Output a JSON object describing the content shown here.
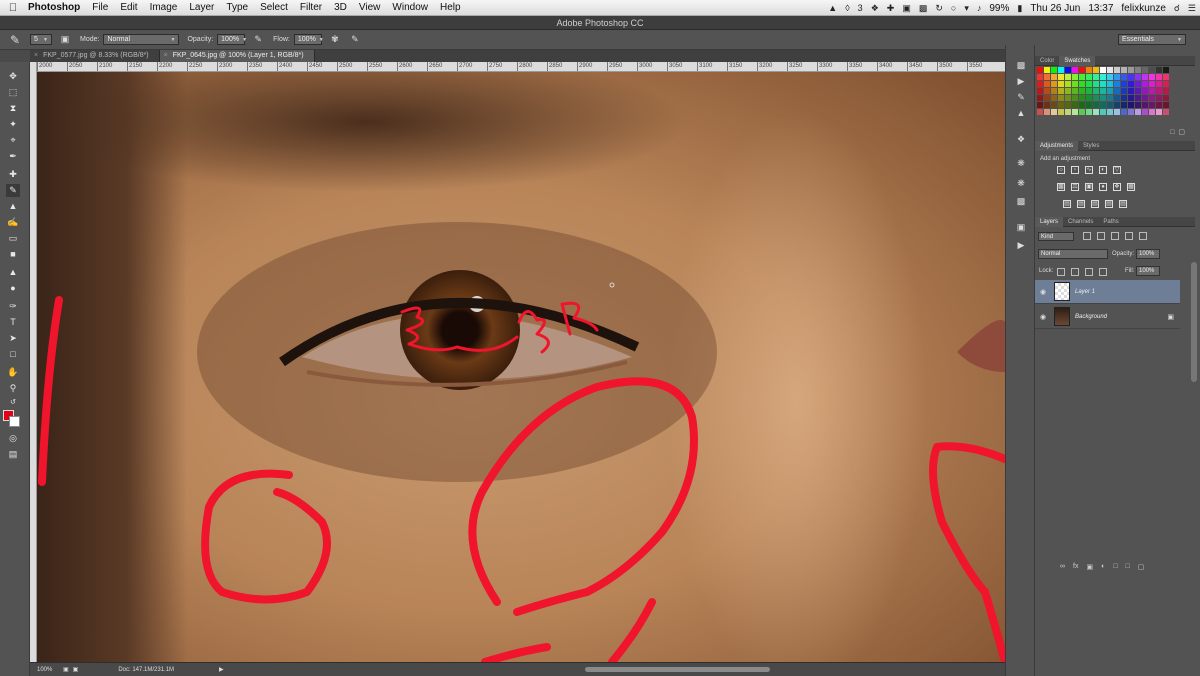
{
  "menubar": {
    "items": [
      "Photoshop",
      "File",
      "Edit",
      "Image",
      "Layer",
      "Type",
      "Select",
      "Filter",
      "3D",
      "View",
      "Window",
      "Help"
    ],
    "status_number": "3",
    "battery": "99%",
    "date": "Thu 26 Jun",
    "time": "13:37",
    "user": "felixkunze"
  },
  "titlebar": {
    "title": "Adobe Photoshop CC"
  },
  "options": {
    "brush_size": "5",
    "mode_label": "Mode:",
    "mode_value": "Normal",
    "opacity_label": "Opacity:",
    "opacity_value": "100%",
    "flow_label": "Flow:",
    "flow_value": "100%",
    "workspace": "Essentials"
  },
  "tabs": [
    {
      "label": "FKP_0577.jpg @ 8.33% (RGB/8*)",
      "active": false
    },
    {
      "label": "FKP_0645.jpg @ 100% (Layer 1, RGB/8*)",
      "active": true
    }
  ],
  "ruler_labels": [
    "2000",
    "2050",
    "2100",
    "2150",
    "2200",
    "2250",
    "2300",
    "2350",
    "2400",
    "2450",
    "2500",
    "2550",
    "2600",
    "2650",
    "2700",
    "2750",
    "2800",
    "2850",
    "2900",
    "2950",
    "3000",
    "3050",
    "3100",
    "3150",
    "3200",
    "3250",
    "3300",
    "3350",
    "3400",
    "3450",
    "3500",
    "3550"
  ],
  "status": {
    "zoom": "100%",
    "doc": "Doc: 147.1M/231.1M"
  },
  "panels": {
    "color_tabs": [
      "Color",
      "Swatches"
    ],
    "adjust_tabs": [
      "Adjustments",
      "Styles"
    ],
    "adjust_title": "Add an adjustment",
    "layer_tabs": [
      "Layers",
      "Channels",
      "Paths"
    ],
    "layer_filter": "Kind",
    "blend_mode": "Normal",
    "opacity_label": "Opacity:",
    "opacity_value": "100%",
    "lock_label": "Lock:",
    "fill_label": "Fill:",
    "fill_value": "100%",
    "layers": [
      {
        "name": "Layer 1",
        "selected": true
      },
      {
        "name": "Background",
        "selected": false,
        "locked": true
      }
    ]
  },
  "colors": {
    "foreground": "#e0001a",
    "background": "#ffffff",
    "annotation": "#f0142c",
    "selected_layer": "#6d7e96"
  },
  "icons": {
    "tools": [
      "move-icon",
      "marquee-icon",
      "lasso-icon",
      "quick-select-icon",
      "crop-icon",
      "eyedropper-icon",
      "healing-icon",
      "brush-icon",
      "clone-stamp-icon",
      "history-brush-icon",
      "eraser-icon",
      "gradient-icon",
      "blur-icon",
      "dodge-icon",
      "pen-icon",
      "type-icon",
      "path-select-icon",
      "shape-icon",
      "hand-icon",
      "zoom-icon"
    ]
  }
}
